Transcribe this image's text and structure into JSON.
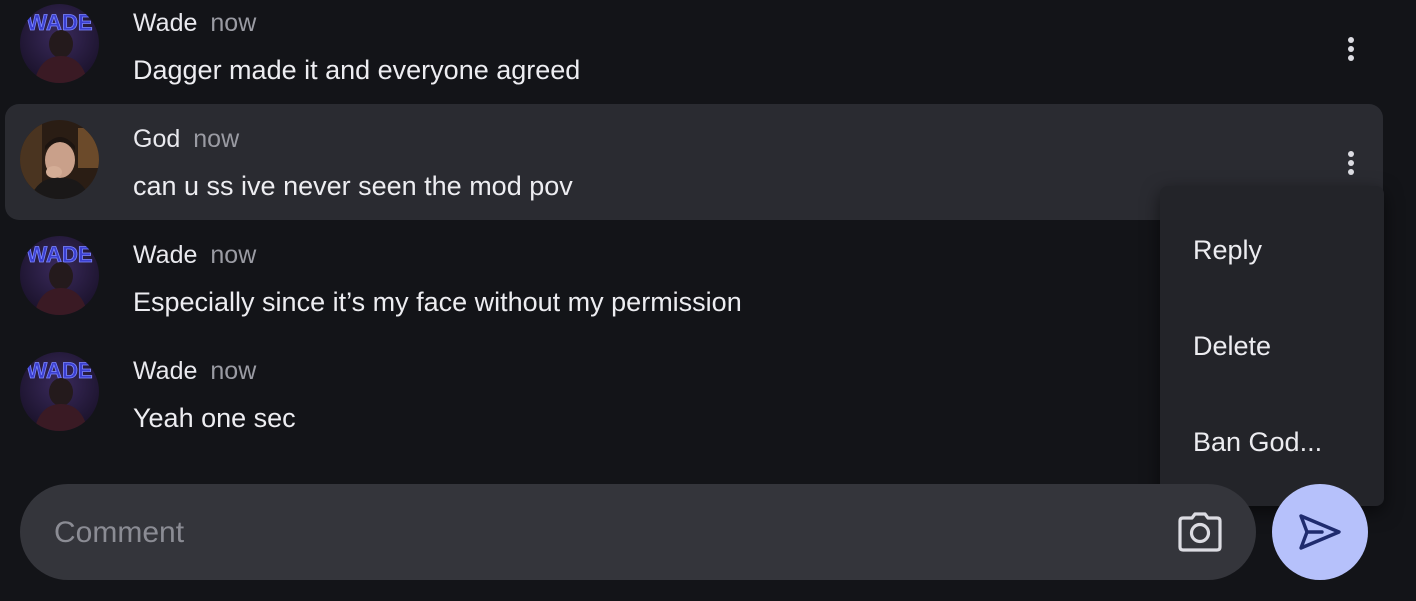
{
  "messages": [
    {
      "author": "Wade",
      "time": "now",
      "text": "Dagger made it and everyone agreed",
      "avatar_label": "WADE"
    },
    {
      "author": "God",
      "time": "now",
      "text": "can u ss ive never seen the mod pov"
    },
    {
      "author": "Wade",
      "time": "now",
      "text": "Especially since it’s my face without my permission",
      "avatar_label": "WADE"
    },
    {
      "author": "Wade",
      "time": "now",
      "text": "Yeah one sec",
      "avatar_label": "WADE"
    }
  ],
  "context_menu": {
    "items": [
      {
        "label": "Reply"
      },
      {
        "label": "Delete"
      },
      {
        "label": "Ban God..."
      }
    ]
  },
  "composer": {
    "placeholder": "Comment",
    "camera_icon": "camera-icon",
    "send_icon": "send-icon"
  },
  "colors": {
    "background": "#131418",
    "highlight_row": "#2a2b31",
    "composer_bg": "#34353b",
    "menu_bg": "#232429",
    "send_button": "#b6c1fb",
    "send_icon": "#1f2b6e"
  }
}
